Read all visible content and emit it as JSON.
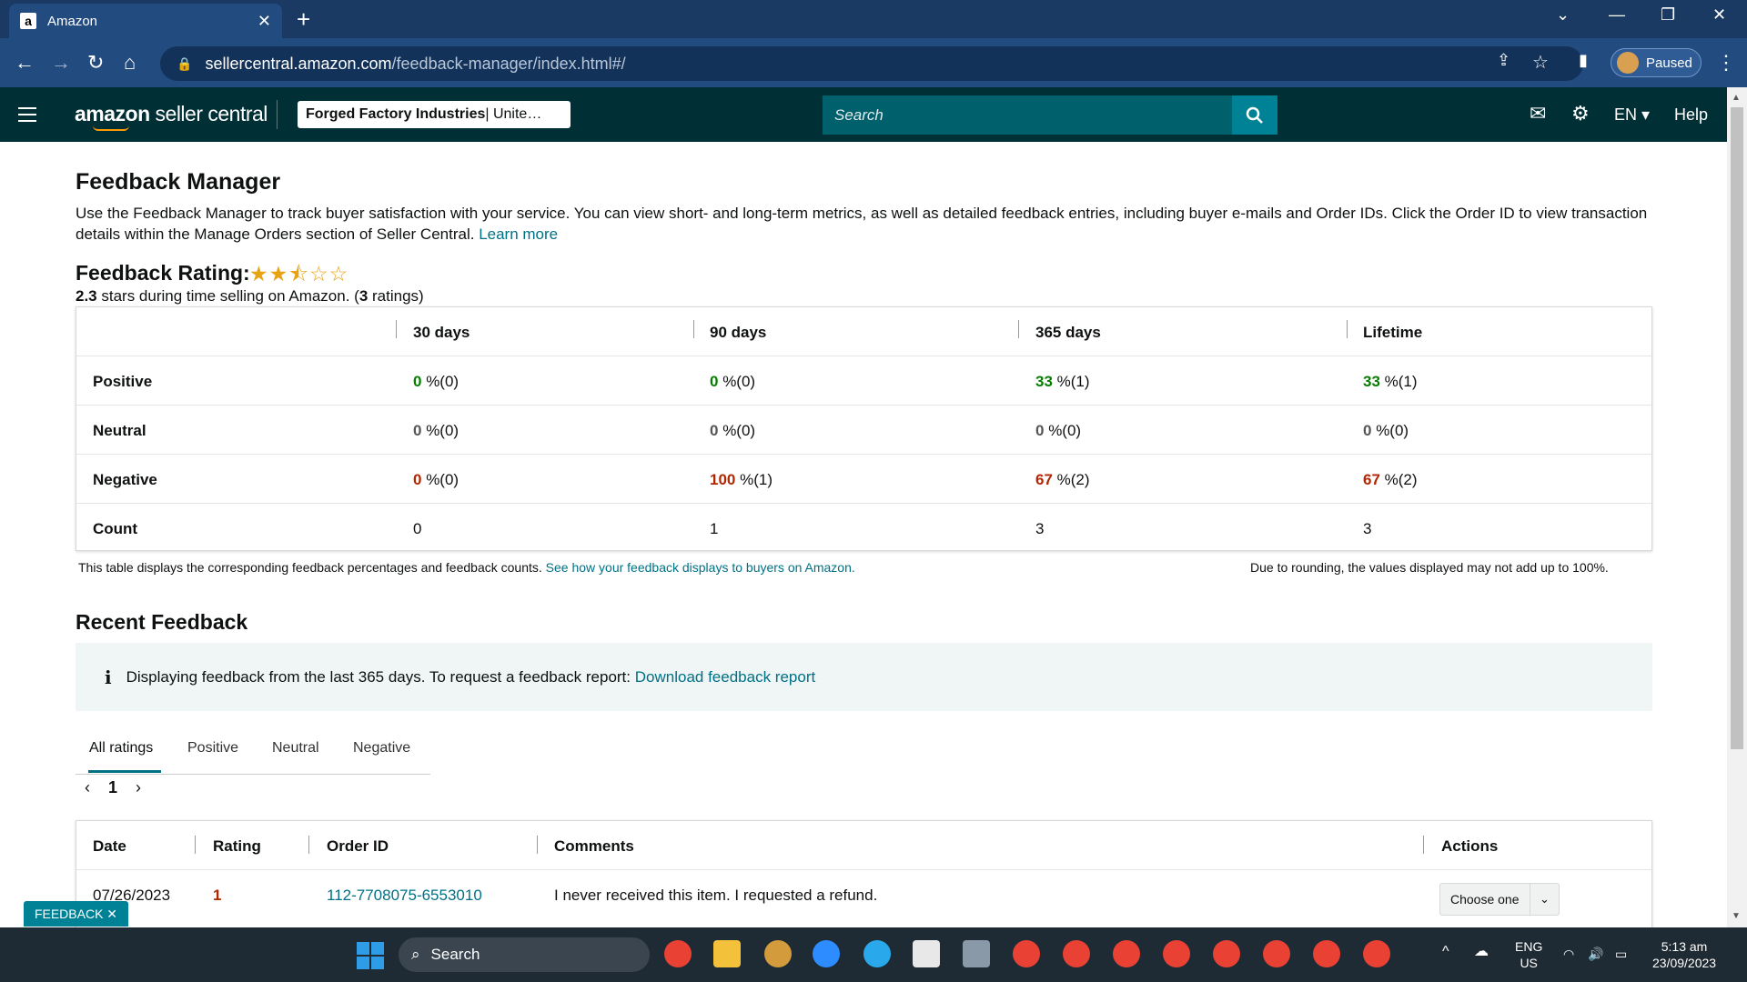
{
  "browser": {
    "tab_title": "Amazon",
    "tab_favicon": "a",
    "url_host": "sellercentral.amazon.com",
    "url_path": "/feedback-manager/index.html#/",
    "profile_label": "Paused"
  },
  "header": {
    "brand_bold": "amazon",
    "brand_rest": " seller central",
    "store_name": "Forged Factory Industries",
    "store_region": " | Unite…",
    "search_placeholder": "Search",
    "language": "EN",
    "help": "Help"
  },
  "page": {
    "title": "Feedback Manager",
    "intro": "Use the Feedback Manager to track buyer satisfaction with your service. You can view short- and long-term metrics, as well as detailed feedback entries, including buyer e-mails and Order IDs. Click the Order ID to view transaction details within the Manage Orders section of Seller Central.",
    "learn_more": "Learn more",
    "rating_title": "Feedback Rating:",
    "stars_value": 2.5,
    "stars_text": "★★⯪☆☆",
    "rating_value": "2.3",
    "rating_sub_mid": " stars during time selling on Amazon. (",
    "rating_count": "3",
    "rating_sub_end": " ratings)"
  },
  "metrics": {
    "columns": [
      "30 days",
      "90 days",
      "365 days",
      "Lifetime"
    ],
    "rows": [
      {
        "label": "Positive",
        "cells": [
          [
            "0",
            " %(0)"
          ],
          [
            "0",
            " %(0)"
          ],
          [
            "33",
            " %(1)"
          ],
          [
            "33",
            " %(1)"
          ]
        ]
      },
      {
        "label": "Neutral",
        "cells": [
          [
            "0",
            " %(0)"
          ],
          [
            "0",
            " %(0)"
          ],
          [
            "0",
            " %(0)"
          ],
          [
            "0",
            " %(0)"
          ]
        ]
      },
      {
        "label": "Negative",
        "cells": [
          [
            "0",
            " %(0)"
          ],
          [
            "100",
            " %(1)"
          ],
          [
            "67",
            " %(2)"
          ],
          [
            "67",
            " %(2)"
          ]
        ]
      },
      {
        "label": "Count",
        "cells": [
          [
            "0",
            ""
          ],
          [
            "1",
            ""
          ],
          [
            "3",
            ""
          ],
          [
            "3",
            ""
          ]
        ]
      }
    ],
    "note_left": "This table displays the corresponding feedback percentages and feedback counts.",
    "note_left_link": "See how your feedback displays to buyers on Amazon.",
    "note_right": "Due to rounding, the values displayed may not add up to 100%."
  },
  "recent": {
    "title": "Recent Feedback",
    "info_text": "Displaying feedback from the last 365 days. To request a feedback report:",
    "info_link": "Download feedback report",
    "tabs": [
      "All ratings",
      "Positive",
      "Neutral",
      "Negative"
    ],
    "page_prev": "‹",
    "page_num": "1",
    "page_next": "›",
    "columns": [
      "Date",
      "Rating",
      "Order ID",
      "Comments",
      "Actions"
    ],
    "rows": [
      {
        "date": "07/26/2023",
        "rating": "1",
        "order_id": "112-7708075-6553010",
        "comment": "I never received this item. I requested a refund.",
        "action": "Choose one"
      }
    ],
    "feedback_badge": "FEEDBACK ✕"
  },
  "taskbar": {
    "search": "Search",
    "lang_top": "ENG",
    "lang_bottom": "US",
    "time": "5:13 am",
    "date": "23/09/2023"
  },
  "colors": {
    "header_bg": "#002f36",
    "accent": "#008296",
    "positive": "#067d00",
    "negative": "#b12704",
    "star": "#e8a312"
  }
}
